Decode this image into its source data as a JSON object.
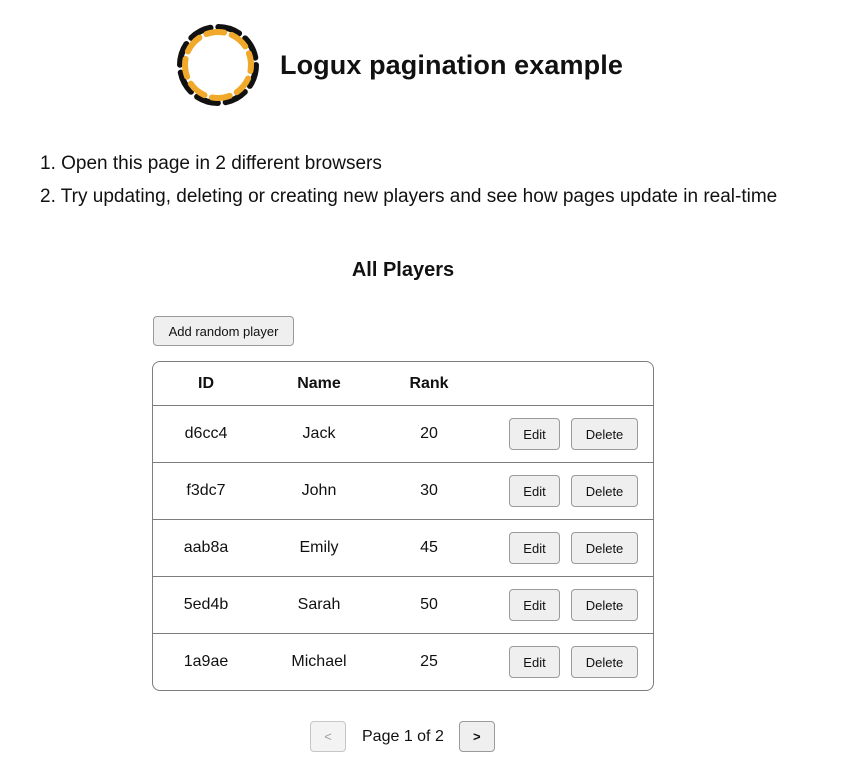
{
  "header": {
    "title": "Logux pagination example",
    "logo": "logux-braid-logo",
    "logo_colors": {
      "orange": "#f0a92b",
      "black": "#111111"
    }
  },
  "instructions": [
    "Open this page in 2 different browsers",
    "Try updating, deleting or creating new players and see how pages update in real-time"
  ],
  "players": {
    "title": "All Players",
    "add_label": "Add random player",
    "columns": [
      "ID",
      "Name",
      "Rank",
      ""
    ],
    "rows": [
      {
        "id": "d6cc4",
        "name": "Jack",
        "rank": "20"
      },
      {
        "id": "f3dc7",
        "name": "John",
        "rank": "30"
      },
      {
        "id": "aab8a",
        "name": "Emily",
        "rank": "45"
      },
      {
        "id": "5ed4b",
        "name": "Sarah",
        "rank": "50"
      },
      {
        "id": "1a9ae",
        "name": "Michael",
        "rank": "25"
      }
    ],
    "edit_label": "Edit",
    "delete_label": "Delete"
  },
  "pagination": {
    "prev_label": "<",
    "next_label": ">",
    "page_label": "Page 1 of 2",
    "prev_disabled": true
  }
}
